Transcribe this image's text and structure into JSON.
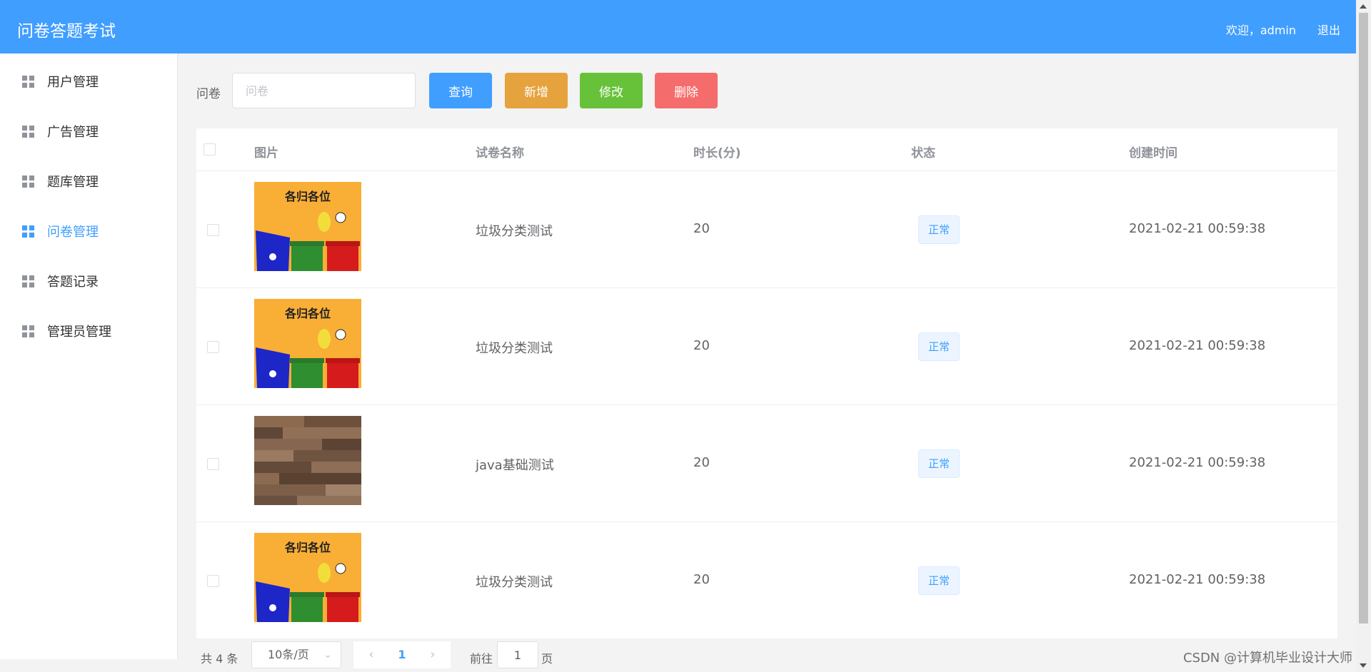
{
  "header": {
    "app_title": "问卷答题考试",
    "welcome": "欢迎，admin",
    "logout": "退出",
    "color": "#409eff"
  },
  "sidebar": {
    "items": [
      {
        "label": "用户管理",
        "icon": "grid-icon",
        "active": false
      },
      {
        "label": "广告管理",
        "icon": "grid-icon",
        "active": false
      },
      {
        "label": "题库管理",
        "icon": "grid-icon",
        "active": false
      },
      {
        "label": "问卷管理",
        "icon": "grid-icon",
        "active": true
      },
      {
        "label": "答题记录",
        "icon": "grid-icon",
        "active": false
      },
      {
        "label": "管理员管理",
        "icon": "grid-icon",
        "active": false
      }
    ]
  },
  "search": {
    "label": "问卷",
    "placeholder": "问卷",
    "value": ""
  },
  "toolbar": {
    "query_label": "查询",
    "add_label": "新增",
    "edit_label": "修改",
    "delete_label": "删除",
    "query_color": "#409eff",
    "add_color": "#e6a23c",
    "edit_color": "#67c23a",
    "delete_color": "#f56c6c"
  },
  "table": {
    "columns": [
      "图片",
      "试卷名称",
      "时长(分)",
      "状态",
      "创建时间"
    ],
    "rows": [
      {
        "image": "garbage-sorting-poster",
        "name": "垃圾分类测试",
        "duration": "20",
        "status": "正常",
        "created": "2021-02-21 00:59:38"
      },
      {
        "image": "garbage-sorting-poster",
        "name": "垃圾分类测试",
        "duration": "20",
        "status": "正常",
        "created": "2021-02-21 00:59:38"
      },
      {
        "image": "wood-texture",
        "name": "java基础测试",
        "duration": "20",
        "status": "正常",
        "created": "2021-02-21 00:59:38"
      },
      {
        "image": "garbage-sorting-poster",
        "name": "垃圾分类测试",
        "duration": "20",
        "status": "正常",
        "created": "2021-02-21 00:59:38"
      }
    ]
  },
  "pagination": {
    "total": "共 4 条",
    "page_size": "10条/页",
    "current_page": "1",
    "goto_label": "前往",
    "goto_value": "1",
    "goto_suffix": "页"
  },
  "watermark": "CSDN @计算机毕业设计大师"
}
